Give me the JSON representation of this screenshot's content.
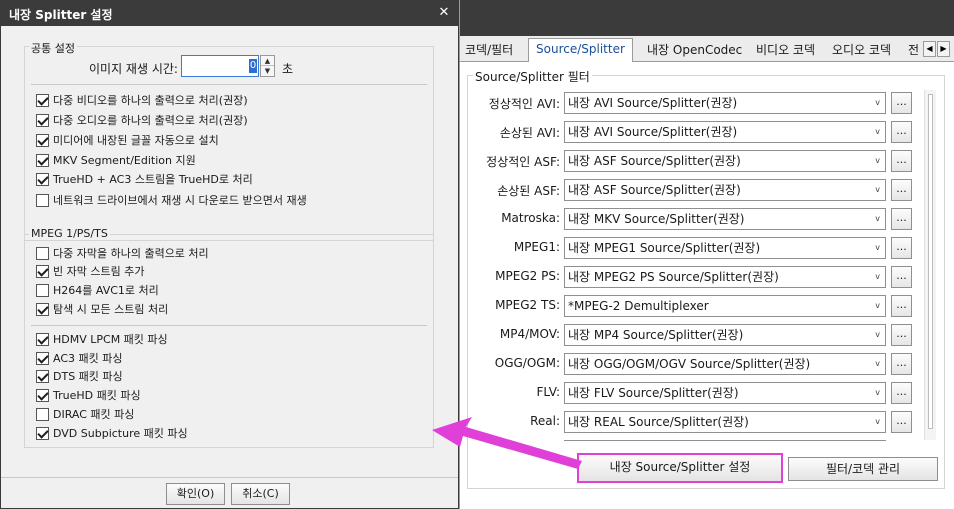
{
  "dialog": {
    "title": "내장 Splitter 설정",
    "close_glyph": "✕",
    "common_group": {
      "label": "공통 설정",
      "image_time_label": "이미지 재생 시간:",
      "image_time_value": "0",
      "image_time_unit": "초",
      "checkboxes": [
        {
          "label": "다중 비디오를 하나의 출력으로 처리(권장)",
          "checked": true
        },
        {
          "label": "다중 오디오를 하나의 출력으로 처리(권장)",
          "checked": true
        },
        {
          "label": "미디어에 내장된 글꼴 자동으로 설치",
          "checked": true
        },
        {
          "label": "MKV Segment/Edition 지원",
          "checked": true
        },
        {
          "label": "TrueHD + AC3 스트림을 TrueHD로 처리",
          "checked": true
        },
        {
          "label": "네트워크 드라이브에서 재생 시 다운로드 받으면서 재생",
          "checked": false
        }
      ]
    },
    "mpeg_group": {
      "label": "MPEG 1/PS/TS",
      "checkboxes_a": [
        {
          "label": "다중 자막을 하나의 출력으로 처리",
          "checked": false
        },
        {
          "label": "빈 자막 스트림 추가",
          "checked": true
        },
        {
          "label": "H264를 AVC1로 처리",
          "checked": false
        },
        {
          "label": "탐색 시 모든 스트림 처리",
          "checked": true
        }
      ],
      "checkboxes_b": [
        {
          "label": "HDMV LPCM 패킷 파싱",
          "checked": true
        },
        {
          "label": "AC3 패킷 파싱",
          "checked": true
        },
        {
          "label": "DTS 패킷 파싱",
          "checked": true
        },
        {
          "label": "TrueHD 패킷 파싱",
          "checked": true
        },
        {
          "label": "DIRAC 패킷 파싱",
          "checked": false
        },
        {
          "label": "DVD Subpicture 패킷 파싱",
          "checked": true
        }
      ]
    },
    "ok_label": "확인(O)",
    "cancel_label": "취소(C)"
  },
  "right_panel": {
    "tabs": [
      "코덱/필터",
      "Source/Splitter",
      "내장 OpenCodec",
      "비디오 코덱",
      "오디오 코덱",
      "전"
    ],
    "active_tab": "Source/Splitter",
    "group_label": "Source/Splitter 필터",
    "rows": [
      {
        "label": "정상적인 AVI:",
        "value": "내장 AVI Source/Splitter(권장)"
      },
      {
        "label": "손상된 AVI:",
        "value": "내장 AVI Source/Splitter(권장)"
      },
      {
        "label": "정상적인 ASF:",
        "value": "내장 ASF Source/Splitter(권장)"
      },
      {
        "label": "손상된 ASF:",
        "value": "내장 ASF Source/Splitter(권장)"
      },
      {
        "label": "Matroska:",
        "value": "내장 MKV Source/Splitter(권장)"
      },
      {
        "label": "MPEG1:",
        "value": "내장 MPEG1 Source/Splitter(권장)"
      },
      {
        "label": "MPEG2 PS:",
        "value": "내장 MPEG2 PS Source/Splitter(권장)"
      },
      {
        "label": "MPEG2 TS:",
        "value": "*MPEG-2 Demultiplexer"
      },
      {
        "label": "MP4/MOV:",
        "value": "내장 MP4 Source/Splitter(권장)"
      },
      {
        "label": "OGG/OGM:",
        "value": "내장 OGG/OGM/OGV Source/Splitter(권장)"
      },
      {
        "label": "FLV:",
        "value": "내장 FLV Source/Splitter(권장)"
      },
      {
        "label": "Real:",
        "value": "내장 REAL Source/Splitter(권장)"
      }
    ],
    "dots_label": "...",
    "builtin_settings_button": "내장 Source/Splitter 설정",
    "filter_manage_button": "필터/코덱 관리"
  },
  "colors": {
    "annotation": "#e040d8",
    "title_bar": "#3b3b3b"
  }
}
